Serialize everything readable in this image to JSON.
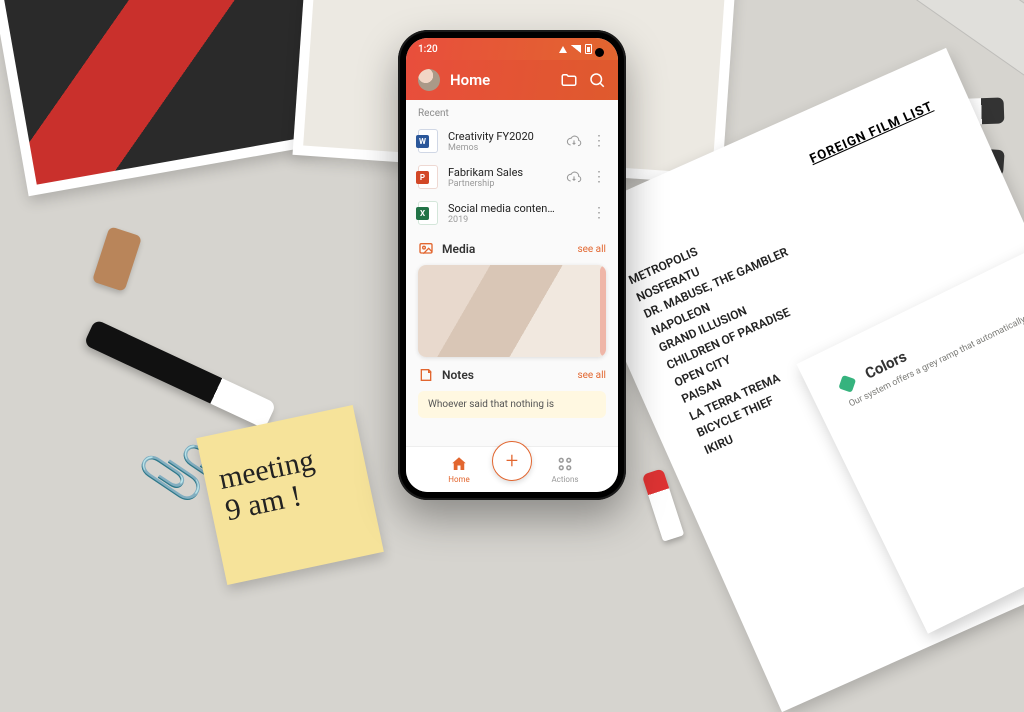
{
  "statusbar": {
    "time": "1:20"
  },
  "header": {
    "title": "Home",
    "folder_icon": "folder-icon",
    "search_icon": "search-icon"
  },
  "recent": {
    "label": "Recent",
    "files": [
      {
        "title": "Creativity FY2020",
        "subtitle": "Memos",
        "type": "word"
      },
      {
        "title": "Fabrikam Sales",
        "subtitle": "Partnership",
        "type": "ppt"
      },
      {
        "title": "Social media content track…",
        "subtitle": "2019",
        "type": "xls"
      }
    ]
  },
  "media": {
    "label": "Media",
    "see_all": "see all"
  },
  "notes": {
    "label": "Notes",
    "see_all": "see all",
    "preview": "Whoever said that nothing is"
  },
  "nav": {
    "home": "Home",
    "actions": "Actions",
    "fab": "+"
  },
  "desk": {
    "sticky_line1": "meeting",
    "sticky_line2": "9 am !",
    "film_list_title": "FOREIGN FILM LIST",
    "films": [
      "METROPOLIS",
      "NOSFERATU",
      "DR. MABUSE, THE GAMBLER",
      "NAPOLEON",
      "GRAND ILLUSION",
      "CHILDREN OF PARADISE",
      "OPEN CITY",
      "PAISAN",
      "LA TERRA TREMA",
      "BICYCLE THIEF",
      "IKIRU"
    ],
    "colors_heading": "Colors",
    "colors_sub": "Our system offers a grey ramp that automatically adjusts"
  },
  "colors": {
    "accent": "#e2662f"
  }
}
